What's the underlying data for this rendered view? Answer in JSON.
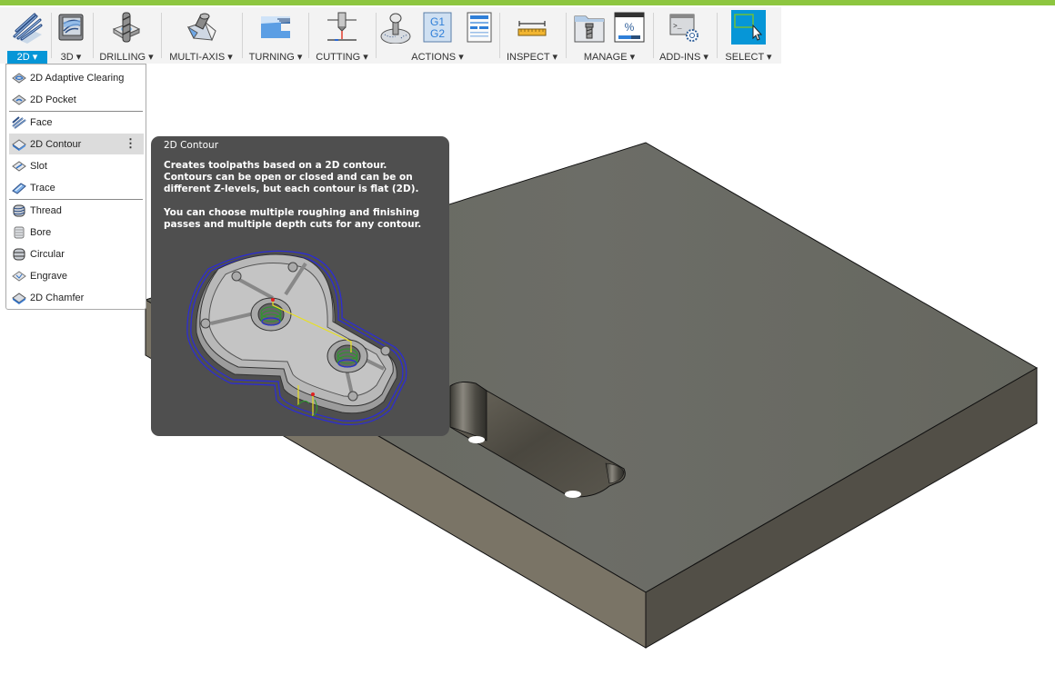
{
  "toolbar": {
    "accent_color": "#8dc63f",
    "active_color": "#0696d7",
    "groups": [
      {
        "label": "2D ▾",
        "icons": [
          "2d-milling-icon"
        ],
        "active": true
      },
      {
        "label": "3D ▾",
        "icons": [
          "3d-milling-icon"
        ]
      },
      {
        "label": "DRILLING ▾",
        "icons": [
          "drill-icon"
        ]
      },
      {
        "label": "MULTI-AXIS ▾",
        "icons": [
          "multi-axis-icon"
        ]
      },
      {
        "label": "TURNING ▾",
        "icons": [
          "turning-icon"
        ]
      },
      {
        "label": "CUTTING ▾",
        "icons": [
          "cutting-icon"
        ]
      },
      {
        "label": "ACTIONS ▾",
        "icons": [
          "simulate-icon",
          "post-process-icon",
          "setup-sheet-icon"
        ]
      },
      {
        "label": "INSPECT ▾",
        "icons": [
          "measure-icon"
        ]
      },
      {
        "label": "MANAGE ▾",
        "icons": [
          "tool-library-icon",
          "task-manager-icon"
        ]
      },
      {
        "label": "ADD-INS ▾",
        "icons": [
          "scripts-addins-icon"
        ]
      },
      {
        "label": "SELECT ▾",
        "icons": [
          "select-icon"
        ]
      }
    ],
    "icon_text": {
      "post_g1": "G1",
      "post_g2": "G2",
      "percent": "%",
      "prompt": ">_"
    }
  },
  "menu": {
    "items": [
      {
        "label": "2D Adaptive Clearing",
        "icon": "adaptive-clearing-icon"
      },
      {
        "label": "2D Pocket",
        "icon": "pocket-icon"
      },
      {
        "label": "Face",
        "icon": "face-icon"
      },
      {
        "label": "2D Contour",
        "icon": "contour-icon",
        "highlighted": true,
        "more": "⋮"
      },
      {
        "label": "Slot",
        "icon": "slot-icon"
      },
      {
        "label": "Trace",
        "icon": "trace-icon"
      },
      {
        "label": "Thread",
        "icon": "thread-icon"
      },
      {
        "label": "Bore",
        "icon": "bore-icon"
      },
      {
        "label": "Circular",
        "icon": "circular-icon"
      },
      {
        "label": "Engrave",
        "icon": "engrave-icon"
      },
      {
        "label": "2D Chamfer",
        "icon": "chamfer-icon"
      }
    ]
  },
  "tooltip": {
    "title": "2D Contour",
    "paragraphs": [
      "Creates toolpaths based on a 2D contour. Contours can be open or closed and can be on different Z-levels, but each contour is flat (2D).",
      "You can choose multiple roughing and finishing passes and multiple depth cuts for any contour."
    ]
  }
}
